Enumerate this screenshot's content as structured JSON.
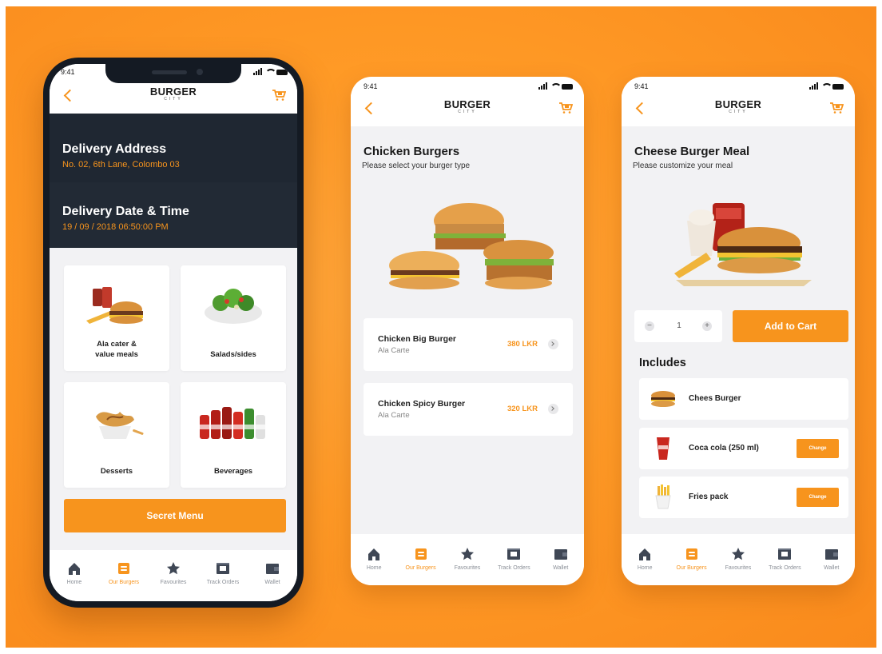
{
  "colors": {
    "accent": "#f7941d",
    "background": "#ff9a26",
    "dark": "#1f2732",
    "text": "#1b1b1b"
  },
  "brand": {
    "name": "BURGER",
    "sub": "CITY"
  },
  "status": {
    "time": "9:41"
  },
  "tabs": [
    {
      "label": "Home",
      "icon": "home-icon"
    },
    {
      "label": "Our Burgers",
      "icon": "burger-box-icon"
    },
    {
      "label": "Favourites",
      "icon": "star-icon"
    },
    {
      "label": "Track Orders",
      "icon": "receipt-icon"
    },
    {
      "label": "Wallet",
      "icon": "wallet-icon"
    }
  ],
  "active_tab": "Our Burgers",
  "screen1": {
    "address_title": "Delivery Address",
    "address_value": "No. 02, 6th Lane, Colombo 03",
    "datetime_title": "Delivery Date & Time",
    "datetime_value": "19 / 09 / 2018  06:50:00 PM",
    "categories": [
      {
        "label": "Ala cater & value meals",
        "icon": "meal-icon"
      },
      {
        "label": "Salads/sides",
        "icon": "salad-icon"
      },
      {
        "label": "Desserts",
        "icon": "dessert-icon"
      },
      {
        "label": "Beverages",
        "icon": "bottles-icon"
      }
    ],
    "secret_button": "Secret Menu"
  },
  "screen2": {
    "title": "Chicken Burgers",
    "subtitle": "Please select your burger type",
    "items": [
      {
        "name": "Chicken Big Burger",
        "type": "Ala Carte",
        "price": "380 LKR"
      },
      {
        "name": "Chicken Spicy Burger",
        "type": "Ala Carte",
        "price": "320 LKR"
      }
    ]
  },
  "screen3": {
    "title": "Cheese Burger Meal",
    "subtitle": "Please customize your meal",
    "quantity": "1",
    "add_to_cart": "Add to Cart",
    "includes_title": "Includes",
    "includes": [
      {
        "label": "Chees Burger",
        "icon": "burger-icon",
        "change": ""
      },
      {
        "label": "Coca cola (250 ml)",
        "icon": "cola-cup-icon",
        "change": "Change"
      },
      {
        "label": "Fries pack",
        "icon": "fries-icon",
        "change": "Change"
      }
    ]
  }
}
